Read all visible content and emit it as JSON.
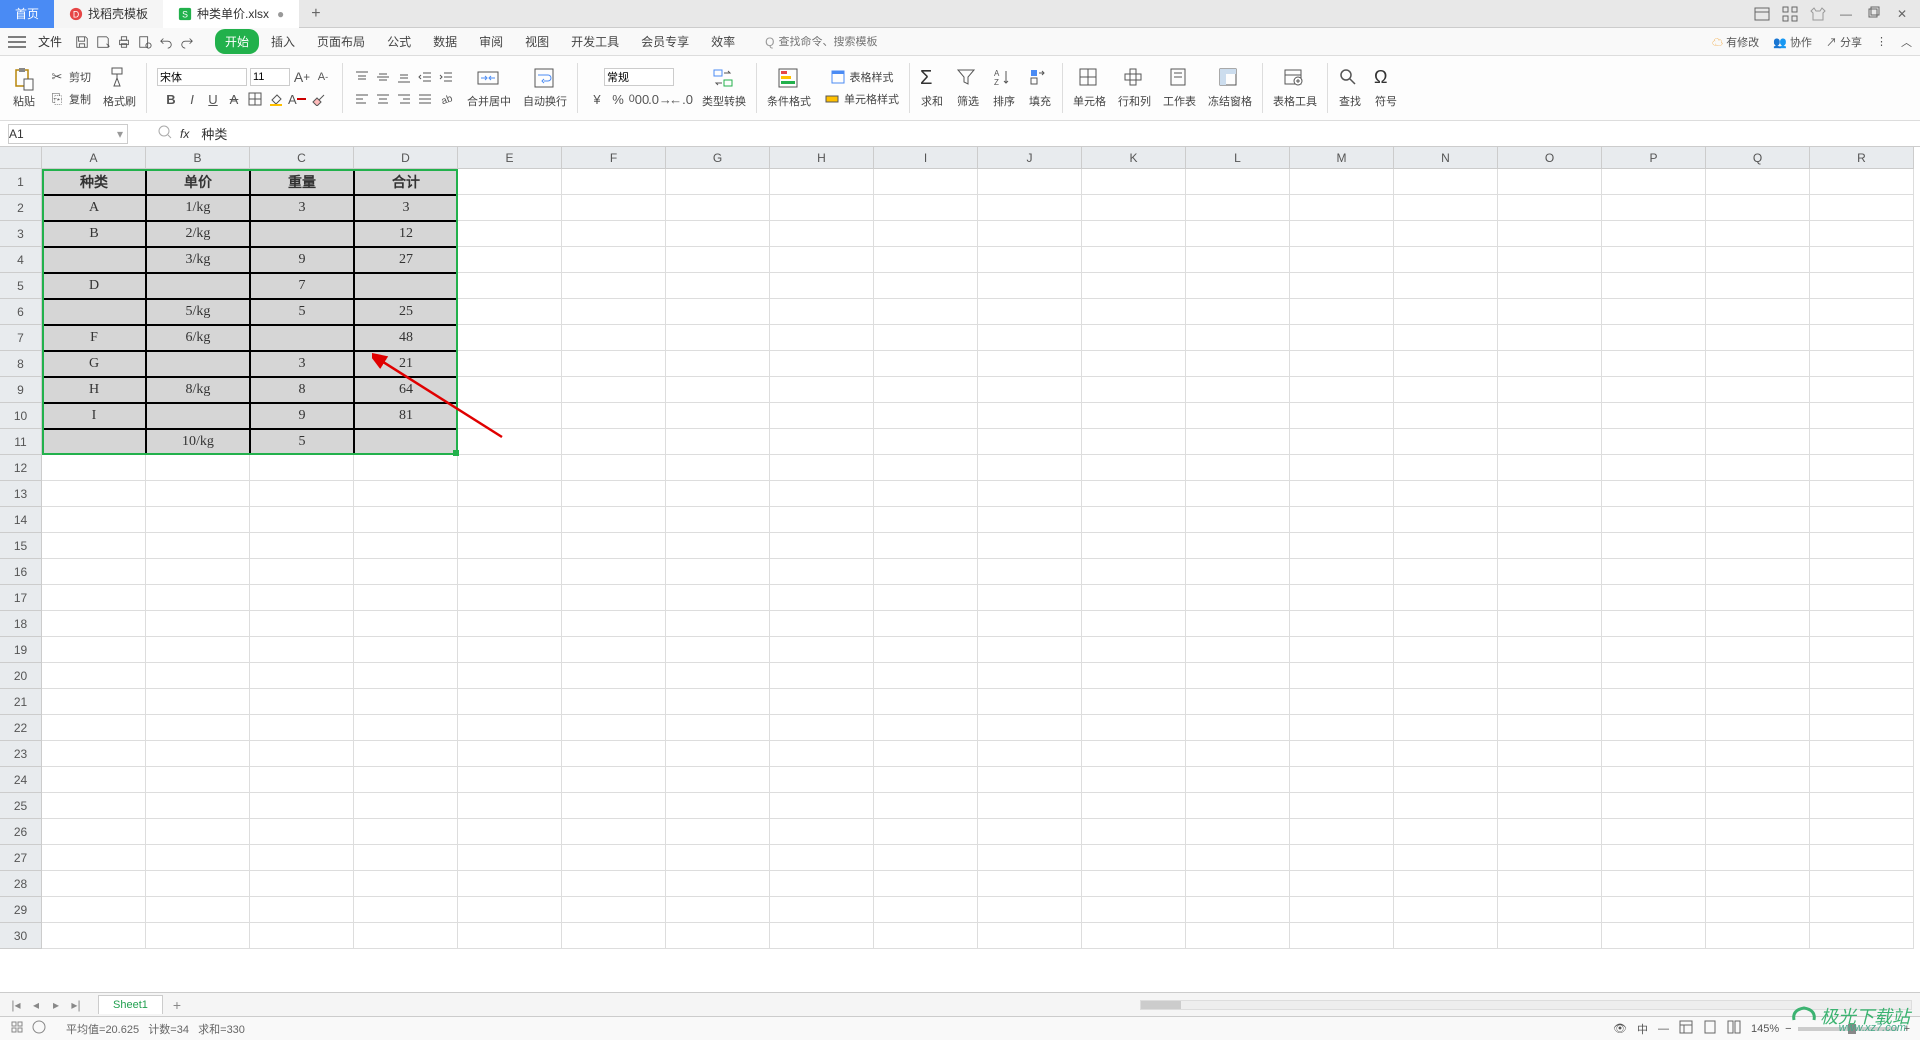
{
  "titlebar": {
    "home_tab": "首页",
    "template_tab": "找稻壳模板",
    "file_tab": "种类单价.xlsx",
    "new_tab_tooltip": "+"
  },
  "menubar": {
    "file": "文件",
    "search_placeholder": "查找命令、搜索模板",
    "search_icon_prefix": "Q",
    "tabs": [
      "开始",
      "插入",
      "页面布局",
      "公式",
      "数据",
      "审阅",
      "视图",
      "开发工具",
      "会员专享",
      "效率"
    ],
    "right": {
      "pending": "有修改",
      "collab": "协作",
      "share": "分享"
    }
  },
  "ribbon": {
    "paste": "粘贴",
    "cut": "剪切",
    "copy": "复制",
    "format_painter": "格式刷",
    "font_name": "宋体",
    "font_size": "11",
    "merge": "合并居中",
    "wrap": "自动换行",
    "number_format": "常规",
    "type_convert": "类型转换",
    "cond_fmt": "条件格式",
    "table_style": "表格样式",
    "cell_style": "单元格样式",
    "sum": "求和",
    "filter": "筛选",
    "sort": "排序",
    "fill": "填充",
    "cells": "单元格",
    "rowcol": "行和列",
    "sheet": "工作表",
    "freeze": "冻结窗格",
    "table_tool": "表格工具",
    "find": "查找",
    "symbol": "符号"
  },
  "namebox": "A1",
  "formula_content": "种类",
  "columns": [
    "A",
    "B",
    "C",
    "D",
    "E",
    "F",
    "G",
    "H",
    "I",
    "J",
    "K",
    "L",
    "M",
    "N",
    "O",
    "P",
    "Q",
    "R"
  ],
  "row_count": 30,
  "table": {
    "headers": [
      "种类",
      "单价",
      "重量",
      "合计"
    ],
    "rows": [
      [
        "A",
        "1/kg",
        "3",
        "3"
      ],
      [
        "B",
        "2/kg",
        "",
        "12"
      ],
      [
        "",
        "3/kg",
        "9",
        "27"
      ],
      [
        "D",
        "",
        "7",
        ""
      ],
      [
        "",
        "5/kg",
        "5",
        "25"
      ],
      [
        "F",
        "6/kg",
        "",
        "48"
      ],
      [
        "G",
        "",
        "3",
        "21"
      ],
      [
        "H",
        "8/kg",
        "8",
        "64"
      ],
      [
        "I",
        "",
        "9",
        "81"
      ],
      [
        "",
        "10/kg",
        "5",
        ""
      ]
    ]
  },
  "sheet_tab": "Sheet1",
  "statusbar": {
    "avg_label": "平均值=",
    "avg_value": "20.625",
    "count_label": "计数=",
    "count_value": "34",
    "sum_label": "求和=",
    "sum_value": "330",
    "zoom": "145%"
  },
  "watermark": {
    "main": "极光下载站",
    "sub": "www.xz7.com"
  }
}
